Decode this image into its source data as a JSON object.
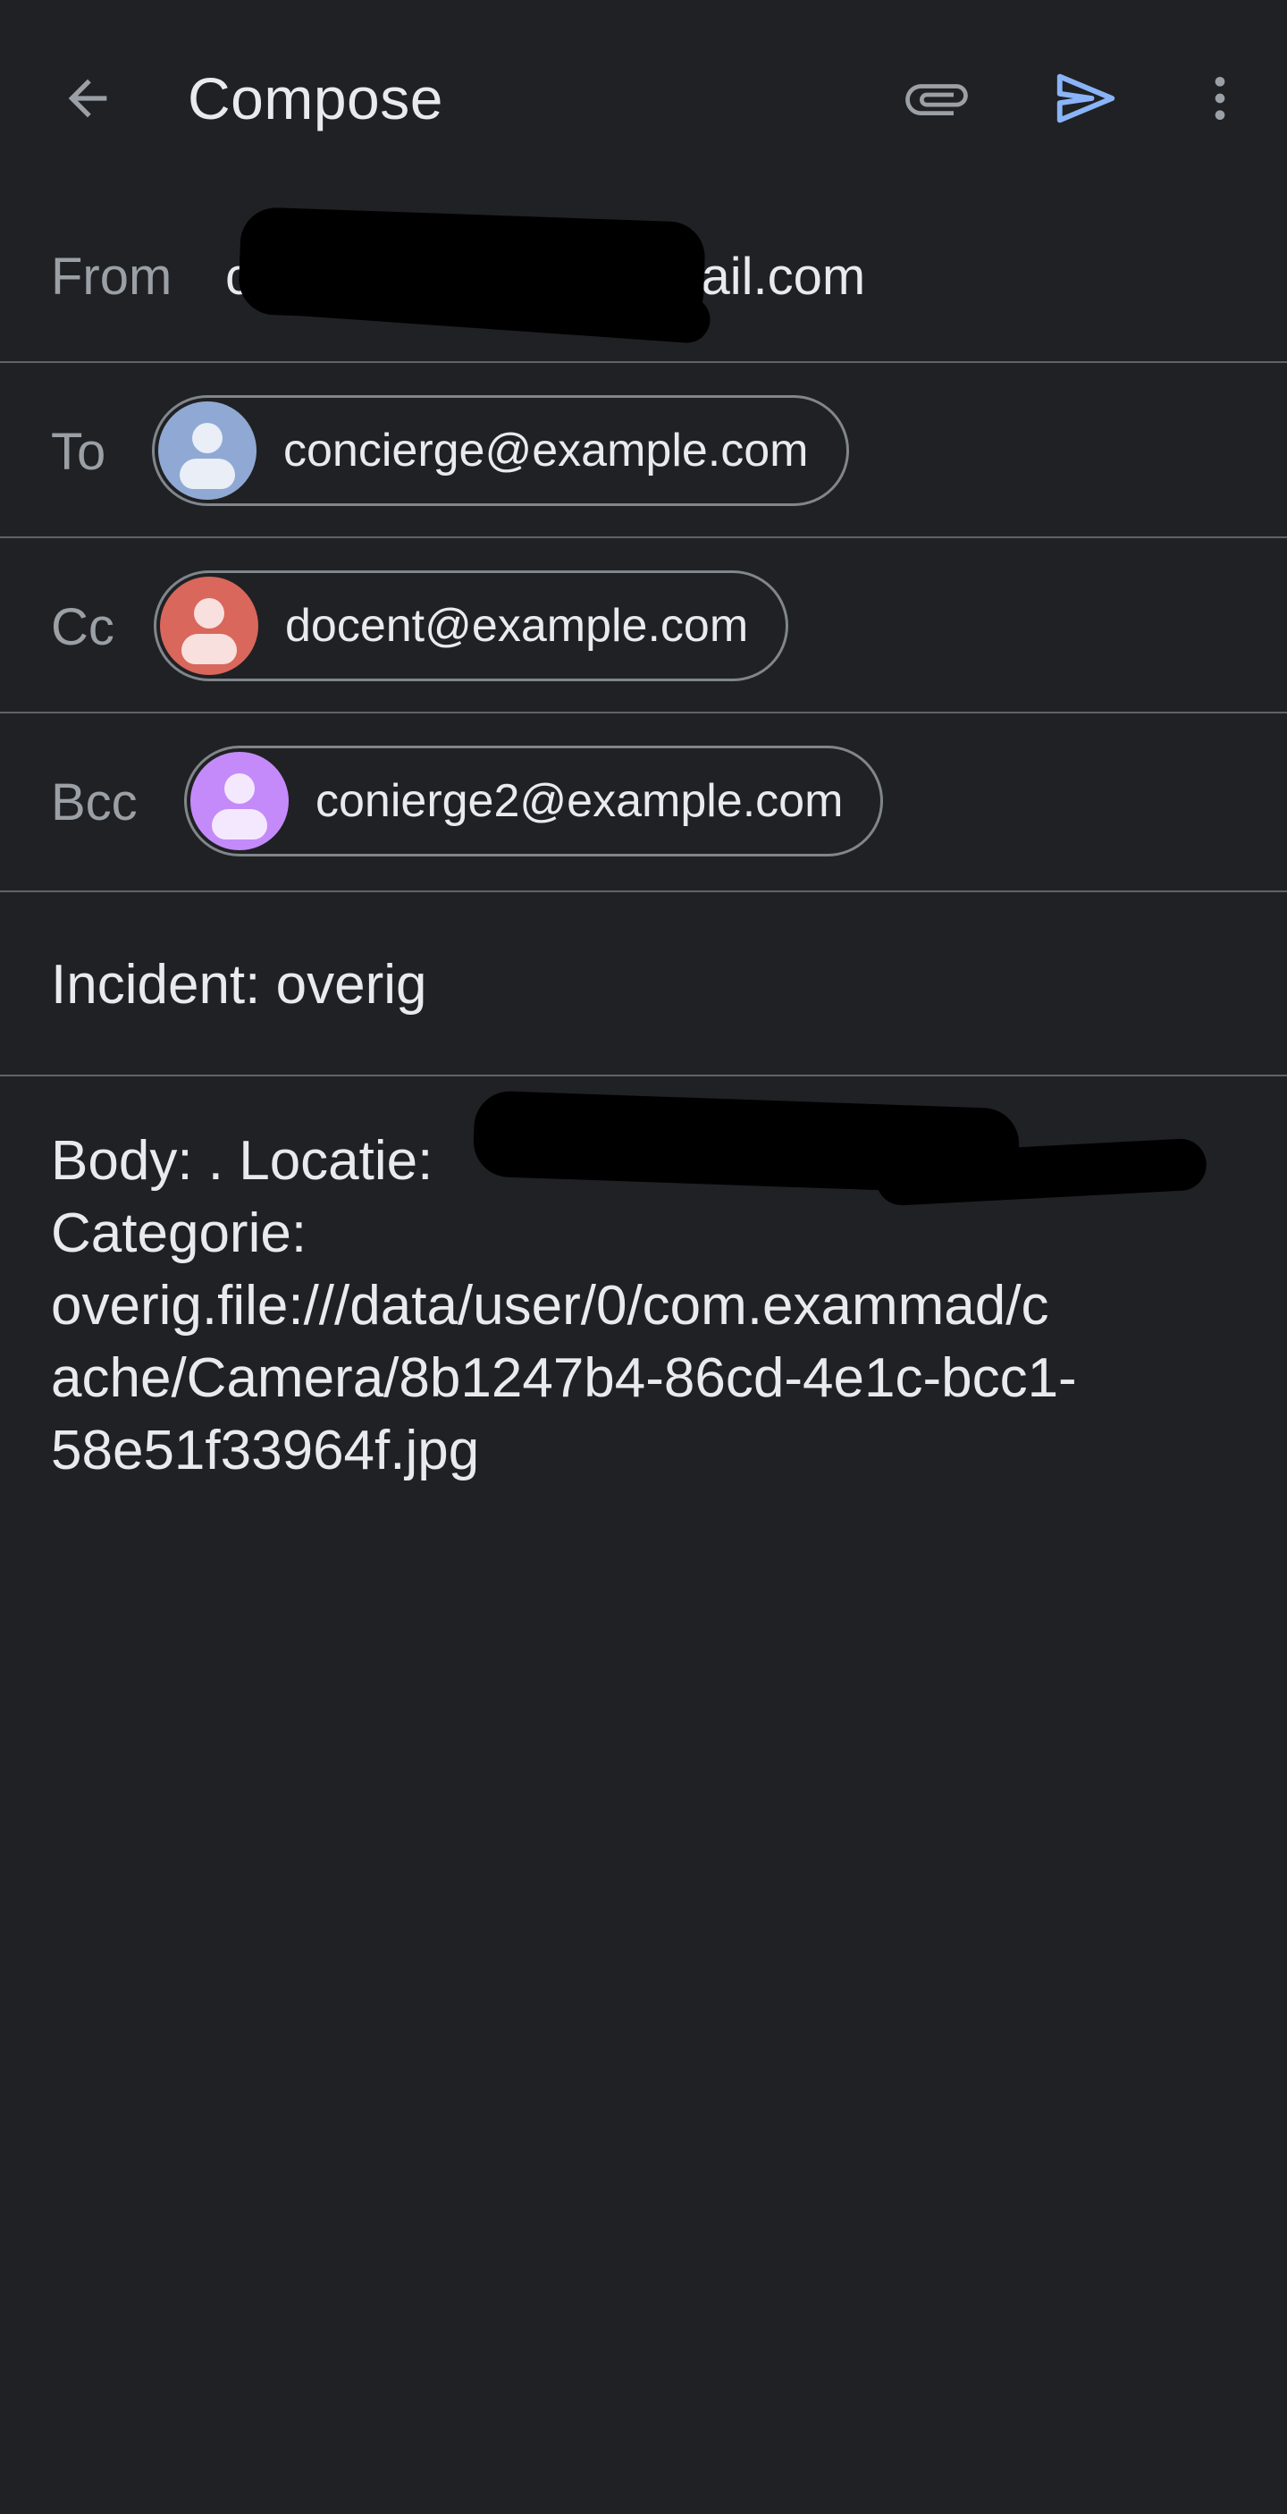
{
  "app_bar": {
    "title": "Compose",
    "icons": {
      "back": "arrow-back-icon",
      "attach": "paperclip-icon",
      "send": "send-icon",
      "more": "more-vert-icon"
    },
    "send_color": "#8ab4f8"
  },
  "from": {
    "label": "From",
    "value_prefix": "c",
    "value_suffix": "@gmail.com"
  },
  "to": {
    "label": "To",
    "chip": {
      "email": "concierge@example.com",
      "avatar_color": "#8fa9d4"
    }
  },
  "cc": {
    "label": "Cc",
    "chip": {
      "email": "docent@example.com",
      "avatar_color": "#d9675c"
    }
  },
  "bcc": {
    "label": "Bcc",
    "chip": {
      "email": "conierge2@example.com",
      "avatar_color": "#c58af9"
    }
  },
  "subject": {
    "value": "Incident: overig"
  },
  "body": {
    "lines": [
      "Body: . Locatie:",
      "Categorie:",
      "overig.file:///data/user/0/com.exammad/c",
      "ache/Camera/8b1247b4-86cd-4e1c-bcc1-",
      "58e51f33964f.jpg"
    ]
  }
}
